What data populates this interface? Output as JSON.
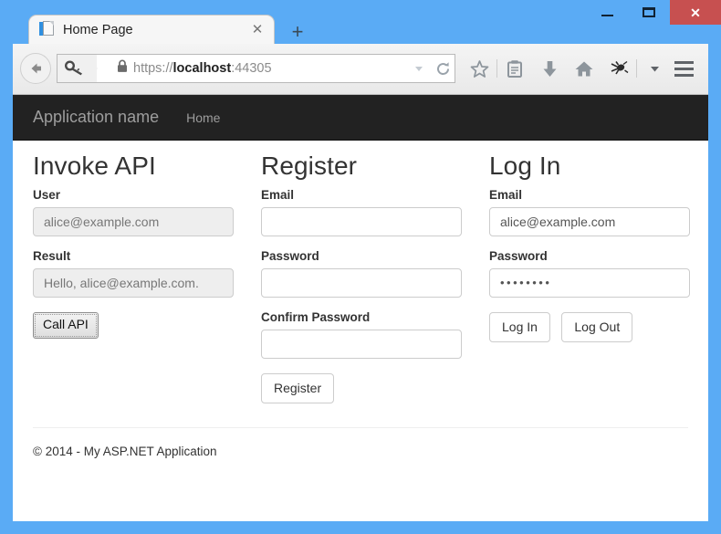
{
  "window": {
    "controls": {
      "minimize": "minimize-icon",
      "restore": "restore-icon",
      "close_glyph": "✕"
    },
    "close_color": "#c75050",
    "frame_color": "#5aabf5"
  },
  "browser": {
    "tab": {
      "title": "Home Page",
      "favicon": "page-icon",
      "close_glyph": "✕"
    },
    "new_tab_glyph": "+",
    "back_glyph": "←",
    "identity_icon": "key-icon",
    "lock_icon": "lock-icon",
    "url": {
      "scheme": "https://",
      "host": "localhost",
      "port": ":44305",
      "full": "https://localhost:44305"
    },
    "url_actions": {
      "dropdown": "chevron-down-icon",
      "reload": "reload-icon"
    },
    "toolbar_icons": [
      "bookmark-star-icon",
      "reading-list-icon",
      "downloads-icon",
      "home-icon",
      "extension-icon",
      "overflow-chevron-icon"
    ],
    "menu_icon": "hamburger-menu-icon"
  },
  "page": {
    "navbar": {
      "brand": "Application name",
      "links": [
        {
          "label": "Home"
        }
      ],
      "background": "#222222",
      "text_color": "#9d9d9d"
    },
    "columns": [
      {
        "heading": "Invoke API",
        "fields": [
          {
            "label": "User",
            "value": "alice@example.com",
            "type": "readonly-text"
          },
          {
            "label": "Result",
            "value": "Hello, alice@example.com.",
            "type": "readonly-text"
          }
        ],
        "buttons": [
          {
            "label": "Call API",
            "style": "native"
          }
        ]
      },
      {
        "heading": "Register",
        "fields": [
          {
            "label": "Email",
            "value": "",
            "type": "text"
          },
          {
            "label": "Password",
            "value": "",
            "type": "password"
          },
          {
            "label": "Confirm Password",
            "value": "",
            "type": "password"
          }
        ],
        "buttons": [
          {
            "label": "Register",
            "style": "bootstrap"
          }
        ]
      },
      {
        "heading": "Log In",
        "fields": [
          {
            "label": "Email",
            "value": "alice@example.com",
            "type": "text"
          },
          {
            "label": "Password",
            "value": "••••••••",
            "type": "password"
          }
        ],
        "buttons": [
          {
            "label": "Log In",
            "style": "bootstrap"
          },
          {
            "label": "Log Out",
            "style": "bootstrap"
          }
        ]
      }
    ],
    "footer": {
      "copyright": "© 2014 - My ASP.NET Application"
    }
  }
}
